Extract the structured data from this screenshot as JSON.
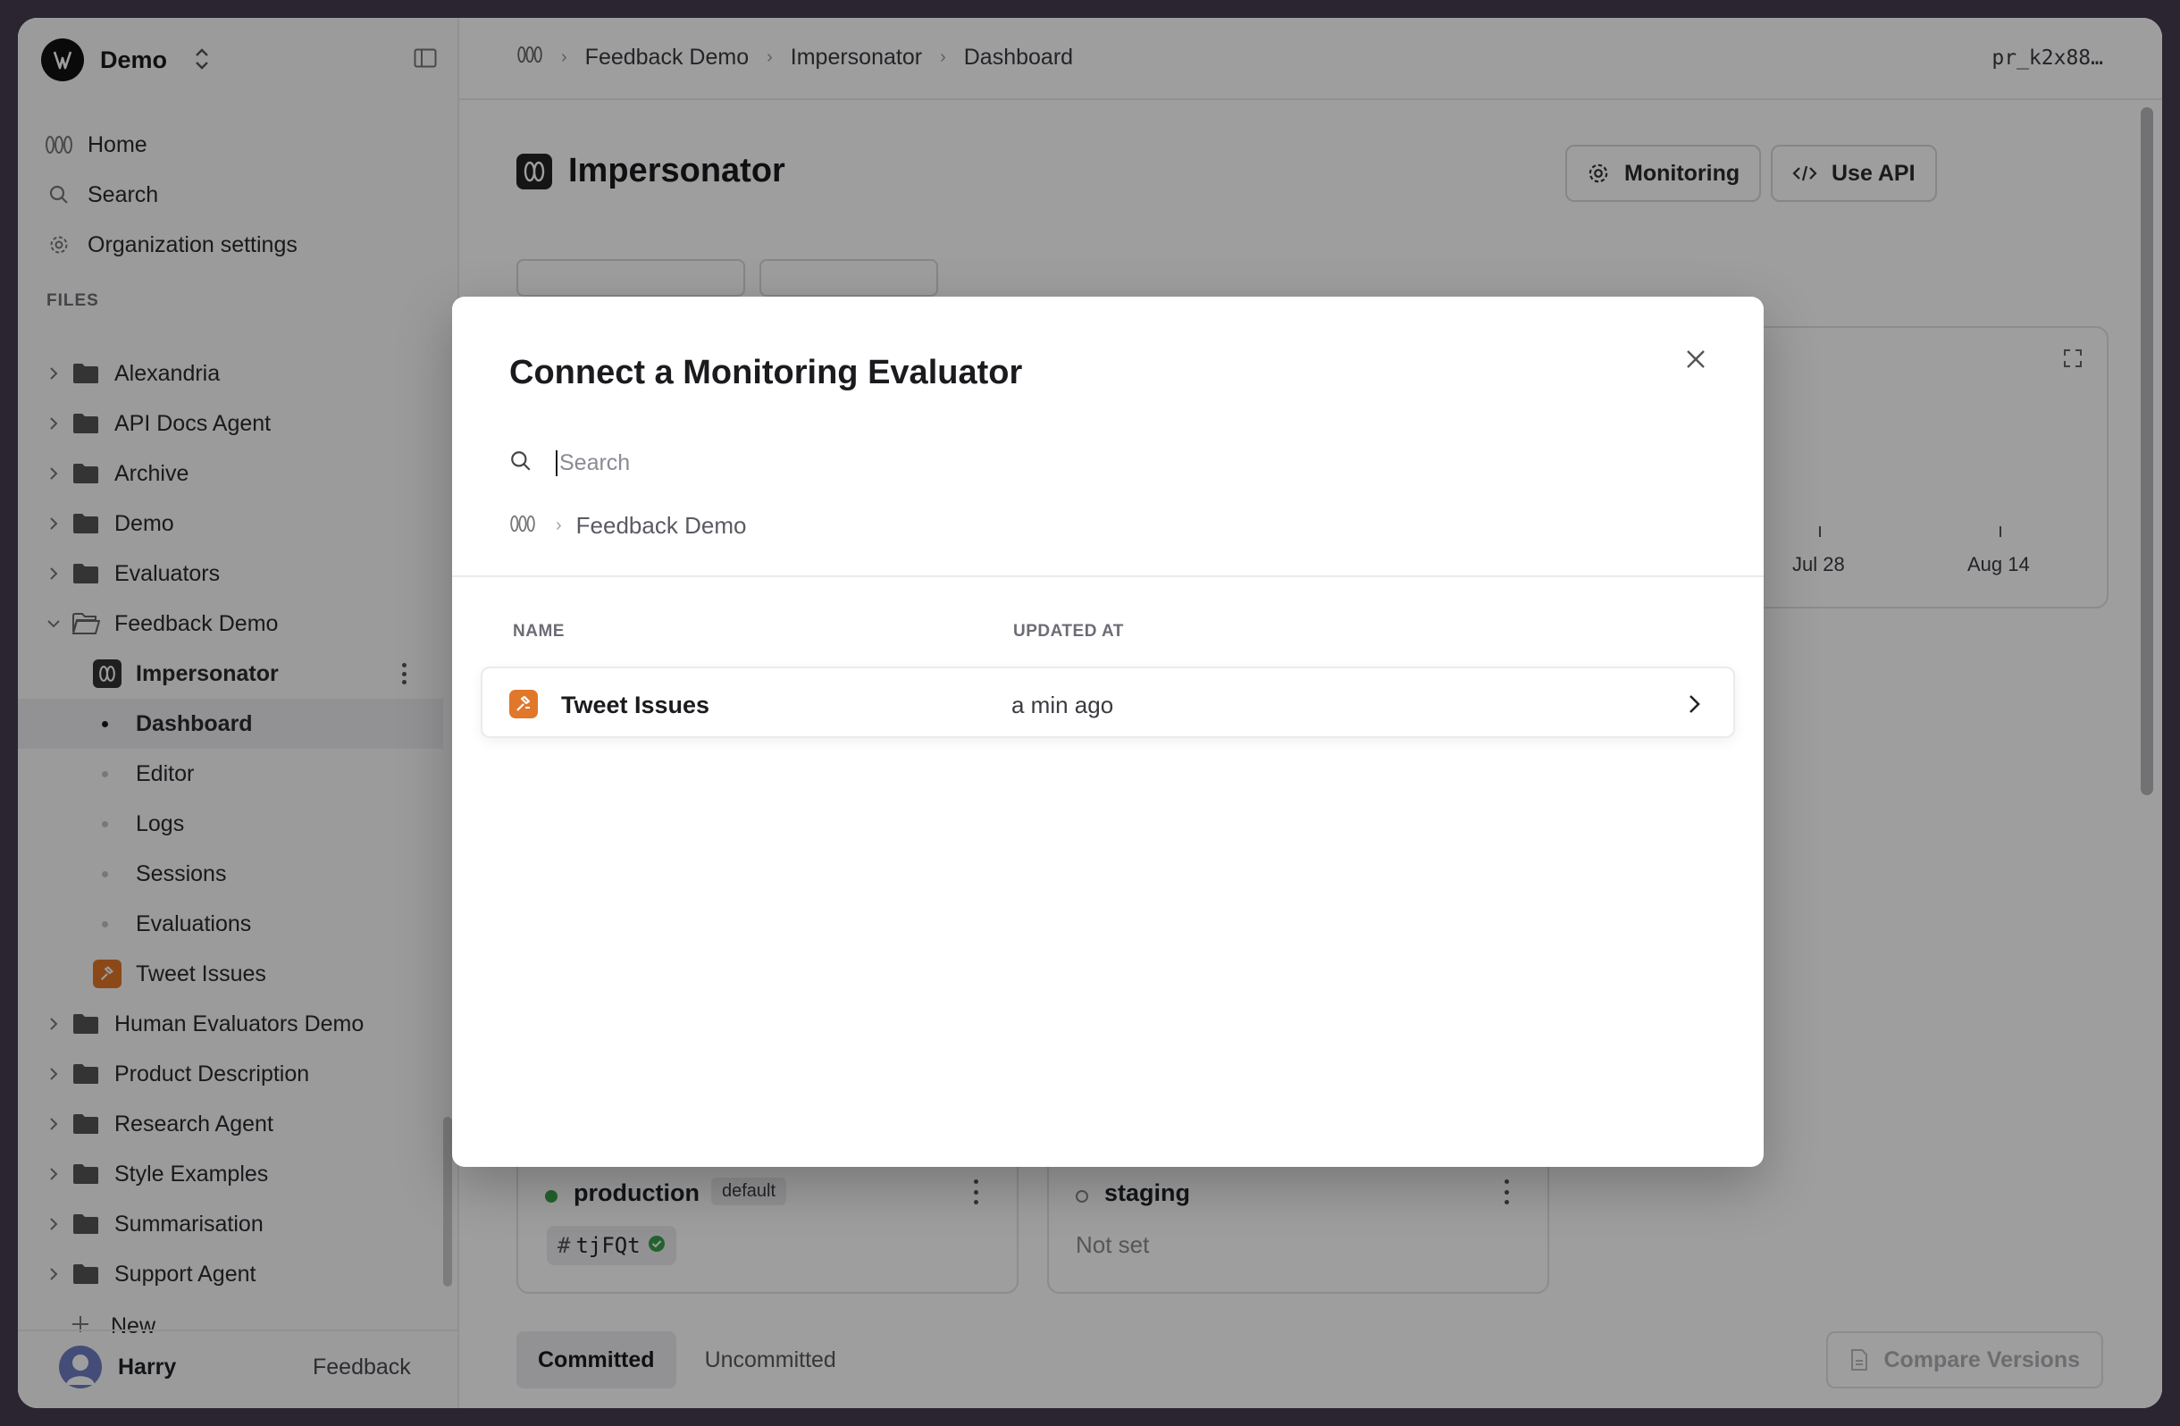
{
  "sidebar": {
    "workspace_name": "Demo",
    "nav": [
      {
        "label": "Home",
        "icon": "humanloop-logo-icon"
      },
      {
        "label": "Search",
        "icon": "search-icon"
      },
      {
        "label": "Organization settings",
        "icon": "gear-icon"
      }
    ],
    "files_label": "FILES",
    "tree": [
      {
        "label": "Alexandria",
        "type": "folder"
      },
      {
        "label": "API Docs Agent",
        "type": "folder"
      },
      {
        "label": "Archive",
        "type": "folder"
      },
      {
        "label": "Demo",
        "type": "folder"
      },
      {
        "label": "Evaluators",
        "type": "folder"
      },
      {
        "label": "Feedback Demo",
        "type": "folder-open"
      },
      {
        "label": "Impersonator",
        "type": "prompt"
      },
      {
        "label": "Dashboard",
        "type": "subpage",
        "active": true
      },
      {
        "label": "Editor",
        "type": "subpage"
      },
      {
        "label": "Logs",
        "type": "subpage"
      },
      {
        "label": "Sessions",
        "type": "subpage"
      },
      {
        "label": "Evaluations",
        "type": "subpage"
      },
      {
        "label": "Tweet Issues",
        "type": "evaluator"
      },
      {
        "label": "Human Evaluators Demo",
        "type": "folder"
      },
      {
        "label": "Product Description",
        "type": "folder"
      },
      {
        "label": "Research Agent",
        "type": "folder"
      },
      {
        "label": "Style Examples",
        "type": "folder"
      },
      {
        "label": "Summarisation",
        "type": "folder"
      },
      {
        "label": "Support Agent",
        "type": "folder"
      }
    ],
    "new_label": "New",
    "user_name": "Harry",
    "feedback_label": "Feedback"
  },
  "topbar": {
    "breadcrumbs": [
      "Feedback Demo",
      "Impersonator",
      "Dashboard"
    ],
    "project_id": "pr_k2x88…"
  },
  "page": {
    "title": "Impersonator",
    "monitoring_label": "Monitoring",
    "use_api_label": "Use API",
    "chart_ticks": [
      "Jul 28",
      "Aug 14"
    ],
    "environments": [
      {
        "name": "production",
        "badge": "default",
        "commit": "tjFQt",
        "status_color": "#3aa14a"
      },
      {
        "name": "staging",
        "value": "Not set"
      }
    ],
    "tabs": [
      "Committed",
      "Uncommitted"
    ],
    "compare_label": "Compare Versions"
  },
  "modal": {
    "title": "Connect a Monitoring Evaluator",
    "search_placeholder": "Search",
    "path": "Feedback Demo",
    "columns": {
      "name": "NAME",
      "updated": "UPDATED AT"
    },
    "rows": [
      {
        "name": "Tweet Issues",
        "updated": "a min ago",
        "icon": "evaluator-icon"
      }
    ]
  },
  "colors": {
    "evaluator_orange": "#e0772a",
    "overlay": "rgba(0,0,0,0.38)",
    "production_green": "#3aa14a"
  }
}
